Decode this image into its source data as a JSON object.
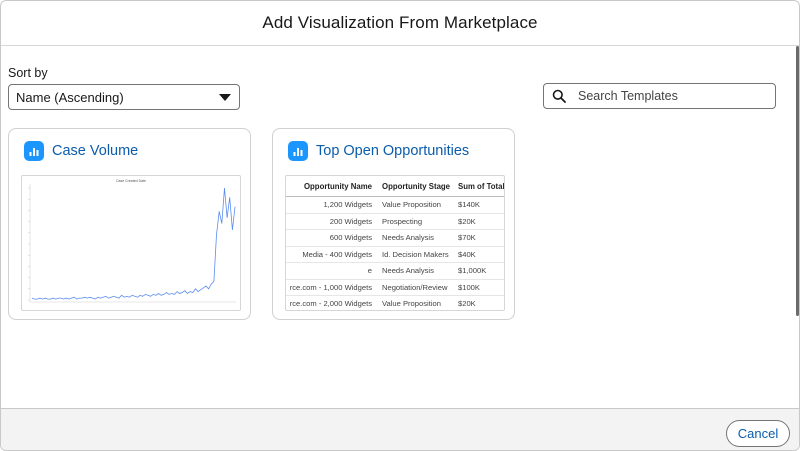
{
  "header": {
    "title": "Add Visualization From Marketplace"
  },
  "filters": {
    "sort_label": "Sort by",
    "sort_value": "Name (Ascending)",
    "search_placeholder": "Search Templates"
  },
  "cards": [
    {
      "title": "Case Volume",
      "icon": "bar-chart-icon",
      "preview": {
        "type": "line",
        "title": "Case Created Date",
        "values": [
          2,
          1,
          1,
          2,
          1,
          2,
          1,
          1,
          2,
          1,
          2,
          2,
          1,
          2,
          1,
          2,
          3,
          1,
          2,
          2,
          3,
          2,
          3,
          2,
          1,
          3,
          2,
          3,
          4,
          2,
          3,
          4,
          3,
          2,
          5,
          3,
          4,
          3,
          5,
          4,
          3,
          5,
          4,
          6,
          5,
          4,
          6,
          5,
          7,
          5,
          6,
          8,
          6,
          7,
          6,
          9,
          7,
          8,
          10,
          7,
          9,
          8,
          12,
          9,
          11,
          13,
          15,
          12,
          17,
          20,
          70,
          95,
          82,
          120,
          88,
          110,
          75,
          100
        ]
      }
    },
    {
      "title": "Top Open Opportunities",
      "icon": "bar-chart-icon",
      "preview": {
        "columns": [
          "Opportunity Name",
          "Opportunity Stage",
          "Sum of Total A"
        ],
        "rows": [
          [
            "1,200 Widgets",
            "Value Proposition",
            "$140K"
          ],
          [
            "200 Widgets",
            "Prospecting",
            "$20K"
          ],
          [
            "600 Widgets",
            "Needs Analysis",
            "$70K"
          ],
          [
            "Media - 400 Widgets",
            "Id. Decision Makers",
            "$40K"
          ],
          [
            "e",
            "Needs Analysis",
            "$1,000K"
          ],
          [
            "rce.com - 1,000 Widgets",
            "Negotiation/Review",
            "$100K"
          ],
          [
            "rce.com - 2,000 Widgets",
            "Value Proposition",
            "$20K"
          ]
        ]
      }
    }
  ],
  "footer": {
    "cancel_label": "Cancel"
  },
  "colors": {
    "accent": "#0b5cab",
    "icon_bg": "#1b96ff",
    "line": "#5b8def"
  }
}
